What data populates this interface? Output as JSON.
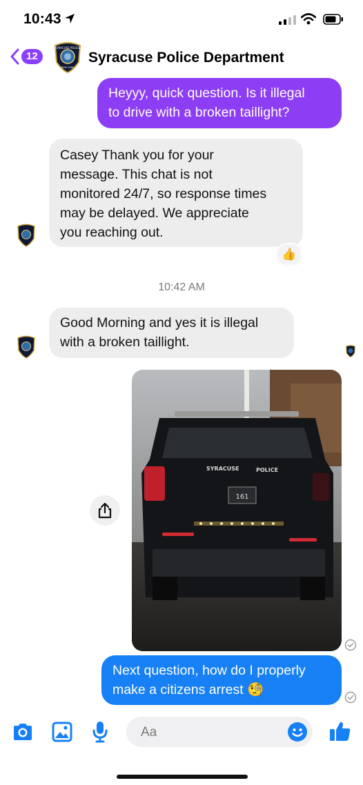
{
  "status_bar": {
    "time": "10:43"
  },
  "header": {
    "back_count": "12",
    "title": "Syracuse Police Department",
    "avatar_text_top": "SYRACUSE POLICE",
    "avatar_text_bottom": "NEW YORK"
  },
  "messages": [
    {
      "type": "out",
      "lines": [
        "Heyyy, quick question. Is it illegal",
        "to drive with a broken taillight?"
      ]
    },
    {
      "type": "in",
      "lines": [
        "Casey Thank you for your",
        "message. This chat is not",
        "monitored 24/7, so response times",
        "may be delayed. We appreciate",
        "you reaching out."
      ],
      "reaction": "👍"
    },
    {
      "type": "timestamp",
      "text": "10:42 AM"
    },
    {
      "type": "in",
      "lines": [
        "Good Morning and yes it is illegal",
        "with a broken taillight."
      ]
    },
    {
      "type": "image",
      "vehicle_text": "SYRACUSE",
      "vehicle_text_2": "POLICE",
      "plate": "161"
    },
    {
      "type": "out",
      "lines": [
        "Next question, how do I properly",
        "make a citizens arrest 🧐"
      ]
    }
  ],
  "composer": {
    "placeholder": "Aa"
  },
  "colors": {
    "accent": "#1780f5",
    "purple": "#8d3df3",
    "incoming": "#ededed"
  }
}
